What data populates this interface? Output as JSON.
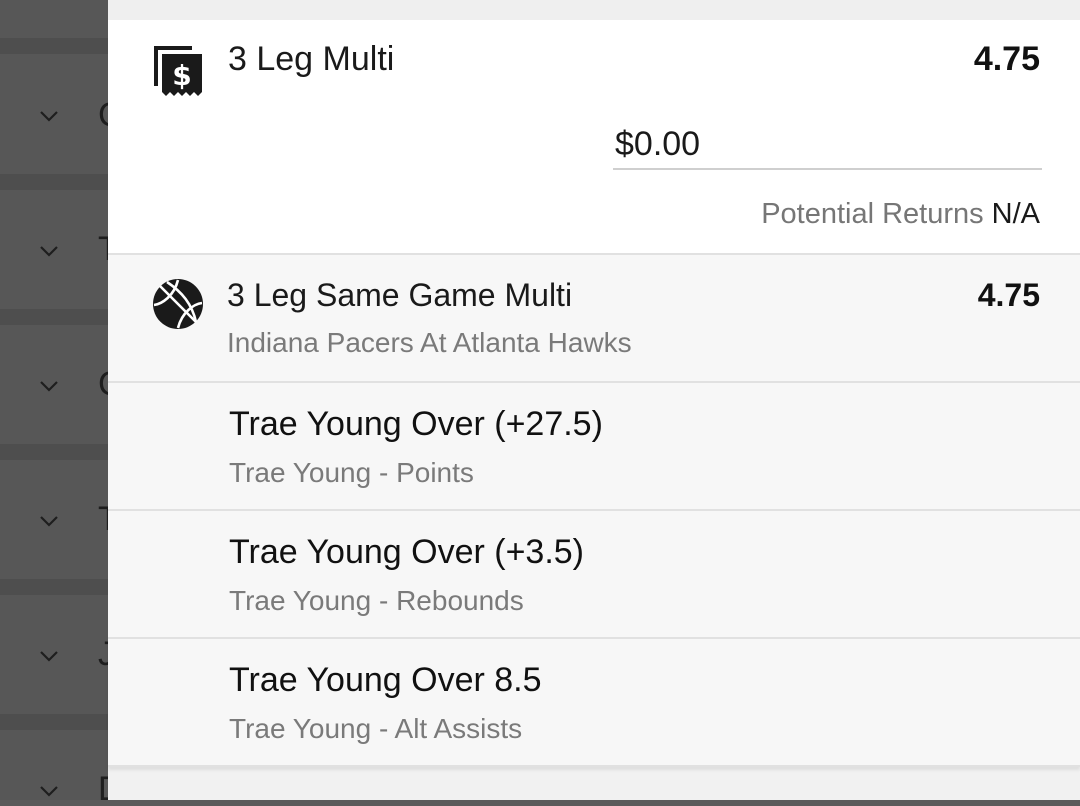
{
  "multi": {
    "title": "3 Leg Multi",
    "odds": "4.75",
    "stake_value": "$0.00",
    "returns_label": "Potential Returns",
    "returns_value": "N/A",
    "icon": "receipt-dollar-icon"
  },
  "same_game_multi": {
    "title": "3 Leg Same Game Multi",
    "odds": "4.75",
    "event": "Indiana Pacers At Atlanta Hawks",
    "icon": "basketball-icon"
  },
  "legs": [
    {
      "selection": "Trae Young Over (+27.5)",
      "market": "Trae Young - Points"
    },
    {
      "selection": "Trae Young Over (+3.5)",
      "market": "Trae Young - Rebounds"
    },
    {
      "selection": "Trae Young Over 8.5",
      "market": "Trae Young - Alt Assists"
    }
  ],
  "background_list": {
    "icon": "chevron-down-icon",
    "row_initials": [
      "C",
      "T",
      "C",
      "T",
      "J",
      "D"
    ]
  },
  "colors": {
    "overlay": "#575757",
    "panel_background": "#f1f1f1",
    "card_background": "#ffffff",
    "leg_background": "#f7f7f7",
    "primary_text": "#1a1a1a",
    "secondary_text": "#7a7a7a",
    "divider": "#e1e1e1"
  }
}
